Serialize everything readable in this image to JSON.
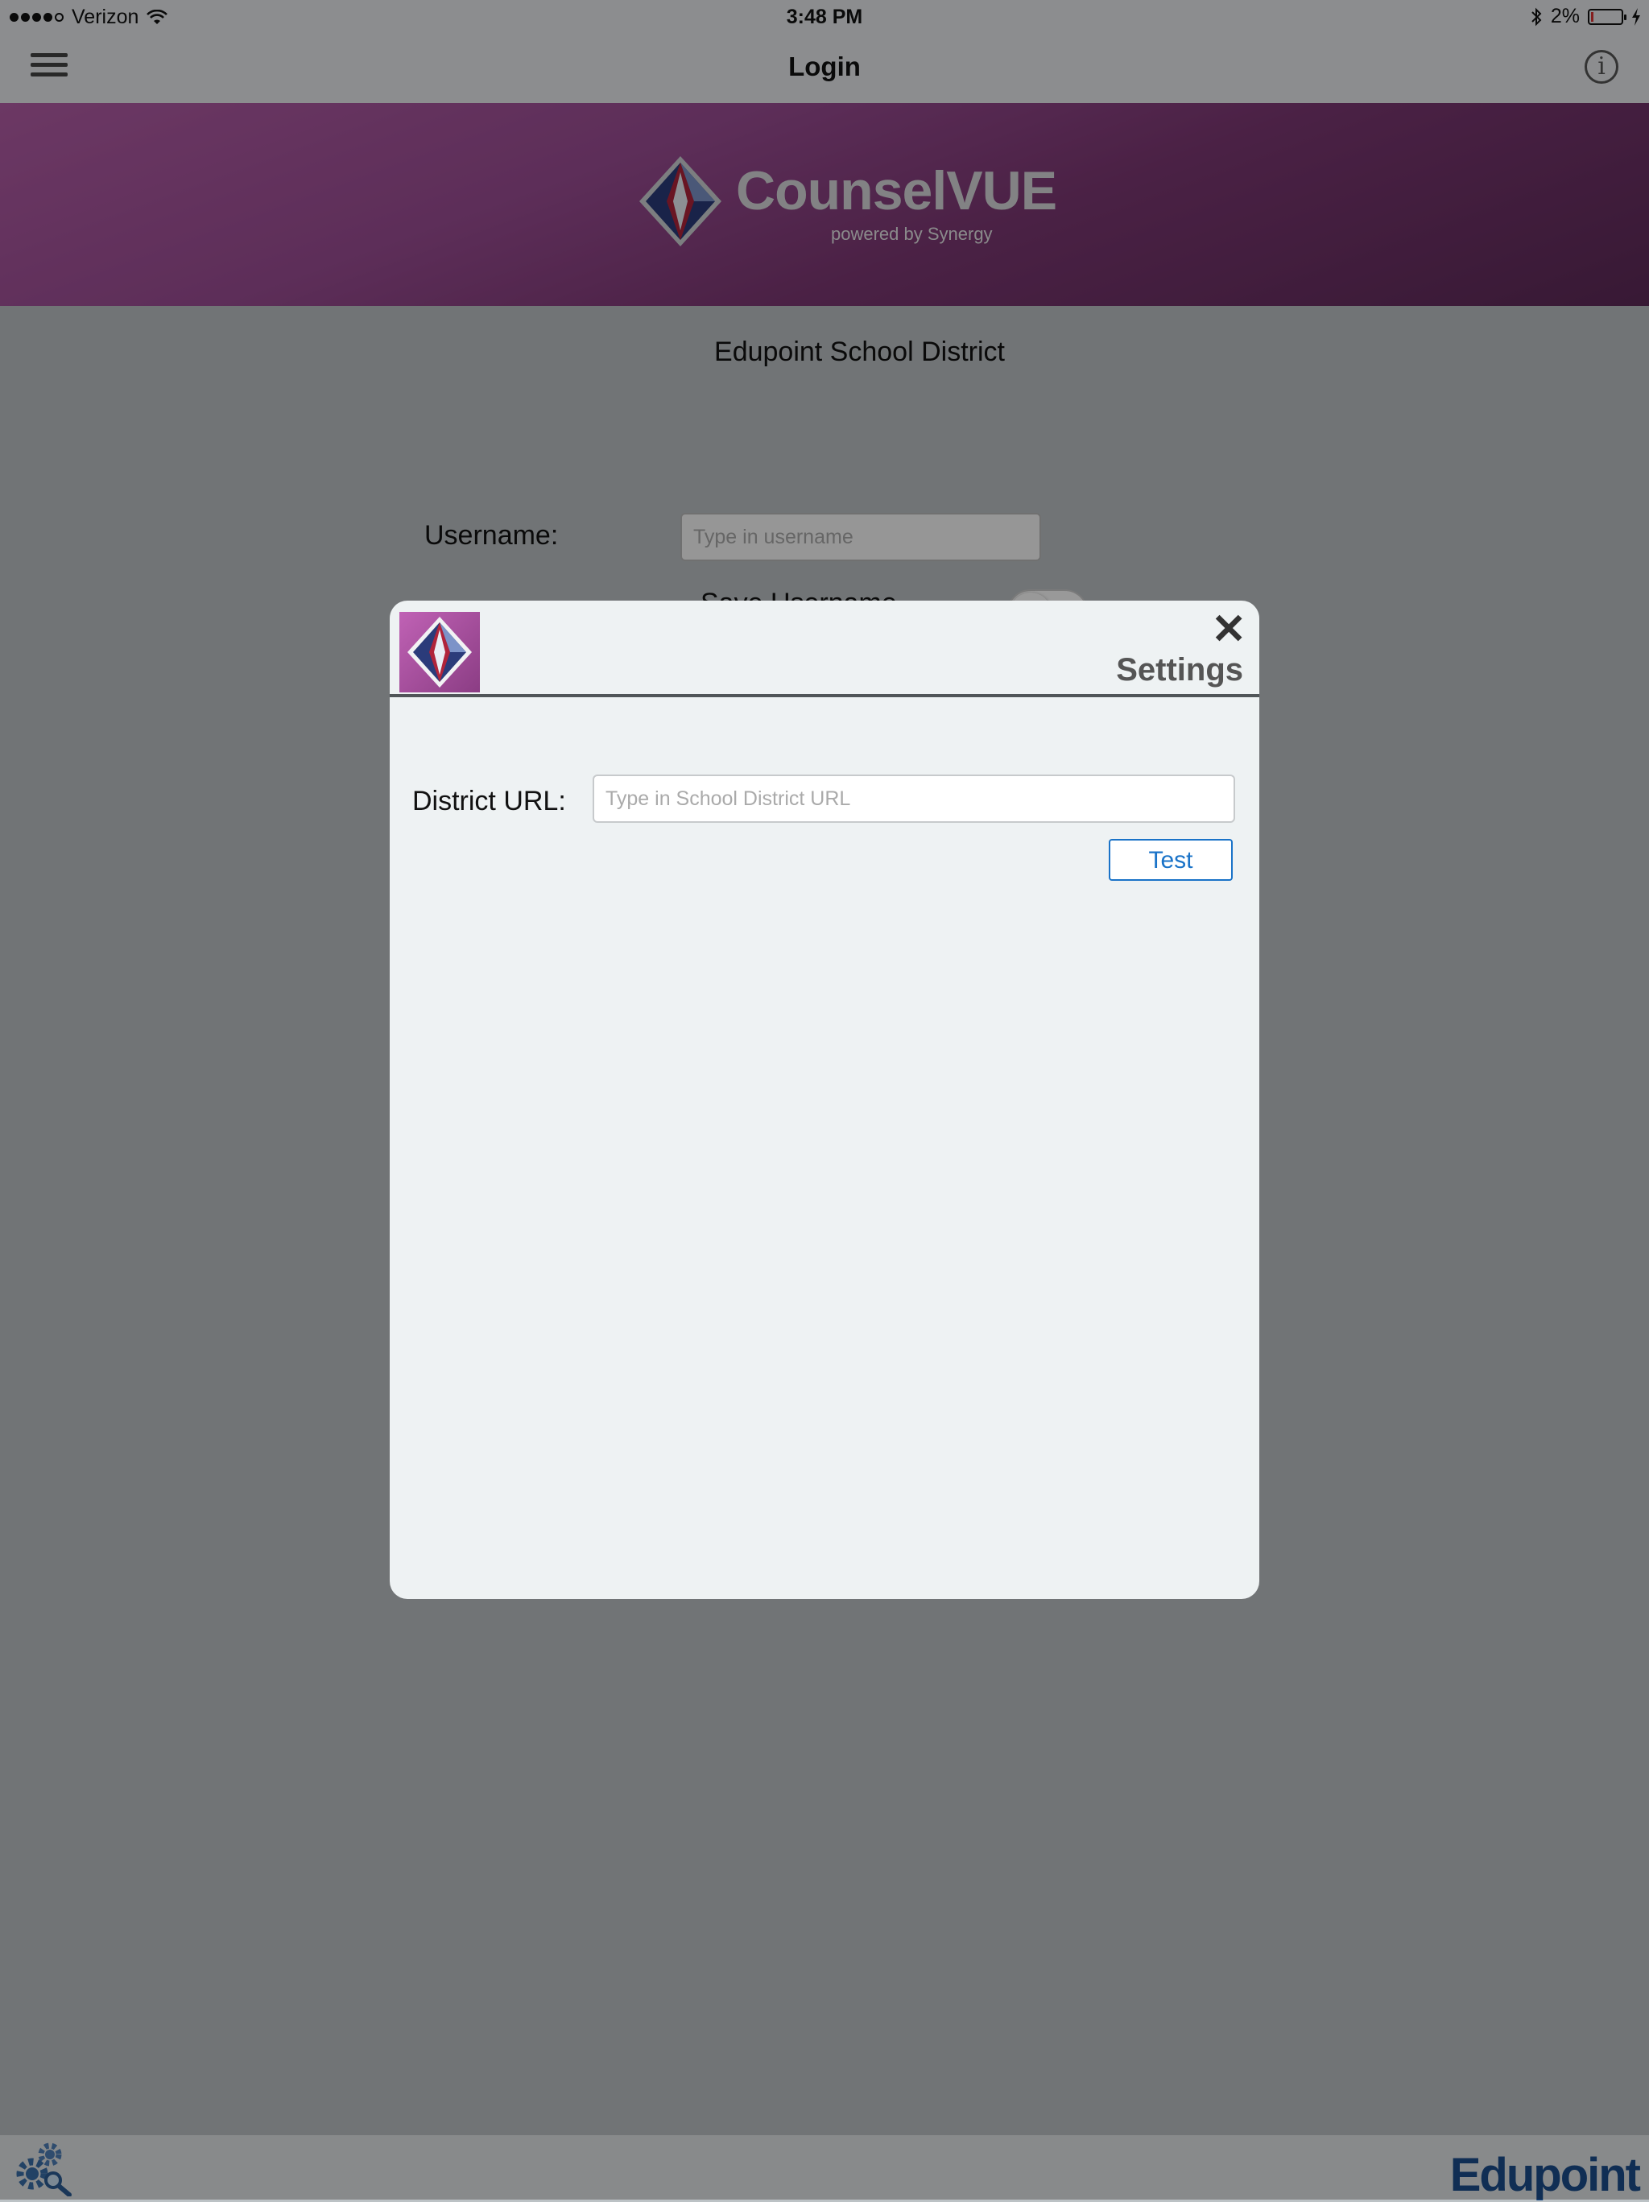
{
  "status_bar": {
    "carrier": "Verizon",
    "time": "3:48 PM",
    "battery": "2%"
  },
  "nav": {
    "title": "Login"
  },
  "banner": {
    "brand": "CounselVUE",
    "tagline": "powered by Synergy"
  },
  "login": {
    "district_name": "Edupoint School District",
    "username_label": "Username:",
    "username_placeholder": "Type in username",
    "save_username_label": "Save Username"
  },
  "footer": {
    "brand": "Edupoint"
  },
  "settings_modal": {
    "title": "Settings",
    "district_url_label": "District URL:",
    "district_url_placeholder": "Type in School District URL",
    "district_url_value": "",
    "test_button_label": "Test"
  },
  "colors": {
    "banner_purple": "#9b4d94",
    "link_blue": "#1a73c8",
    "edupoint_blue": "#1b4d8c"
  }
}
